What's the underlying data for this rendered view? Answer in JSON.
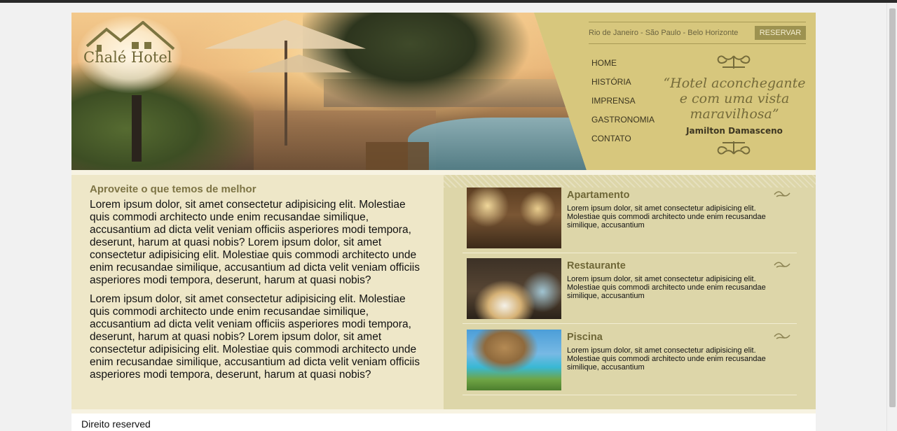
{
  "brand": {
    "name": "Chalé Hotel"
  },
  "header": {
    "cities": "Rio de Janeiro - São Paulo - Belo Horizonte",
    "reserve_label": "RESERVAR",
    "nav": [
      "HOME",
      "HISTÓRIA",
      "IMPRENSA",
      "GASTRONOMIA",
      "CONTATO"
    ],
    "quote": "“Hotel aconchegante e com uma vista maravilhosa”",
    "author": "Jamilton Damasceno"
  },
  "main": {
    "heading": "Aproveite o que temos de melhor",
    "paragraphs": [
      "Lorem ipsum dolor, sit amet consectetur adipisicing elit. Molestiae quis commodi architecto unde enim recusandae similique, accusantium ad dicta velit veniam officiis asperiores modi tempora, deserunt, harum at quasi nobis? Lorem ipsum dolor, sit amet consectetur adipisicing elit. Molestiae quis commodi architecto unde enim recusandae similique, accusantium ad dicta velit veniam officiis asperiores modi tempora, deserunt, harum at quasi nobis?",
      "Lorem ipsum dolor, sit amet consectetur adipisicing elit. Molestiae quis commodi architecto unde enim recusandae similique, accusantium ad dicta velit veniam officiis asperiores modi tempora, deserunt, harum at quasi nobis? Lorem ipsum dolor, sit amet consectetur adipisicing elit. Molestiae quis commodi architecto unde enim recusandae similique, accusantium ad dicta velit veniam officiis asperiores modi tempora, deserunt, harum at quasi nobis?"
    ]
  },
  "features": [
    {
      "title": "Apartamento",
      "text": "Lorem ipsum dolor, sit amet consectetur adipisicing elit. Molestiae quis commodi architecto unde enim recusandae similique, accusantium"
    },
    {
      "title": "Restaurante",
      "text": "Lorem ipsum dolor, sit amet consectetur adipisicing elit. Molestiae quis commodi architecto unde enim recusandae similique, accusantium"
    },
    {
      "title": "Piscina",
      "text": "Lorem ipsum dolor, sit amet consectetur adipisicing elit. Molestiae quis commodi architecto unde enim recusandae similique, accusantium"
    }
  ],
  "footer": {
    "text": "Direito reserved"
  }
}
